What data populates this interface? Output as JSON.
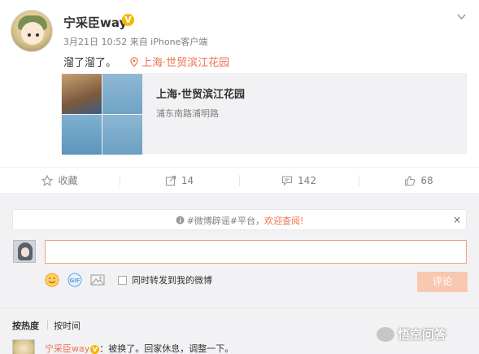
{
  "post": {
    "username": "宁采臣way",
    "verified_badge": "V",
    "meta": "3月21日 10:52 来自 iPhone客户端",
    "text": "溜了溜了。",
    "location_link": "上海·世贸滨江花园",
    "card": {
      "title": "上海·世贸滨江花园",
      "subtitle": "浦东南路浦明路"
    }
  },
  "actions": {
    "favorite": "收藏",
    "repost_count": "14",
    "comment_count": "142",
    "like_count": "68"
  },
  "comments": {
    "notice_prefix": "#微博辟谣#平台，",
    "notice_highlight": "欢迎查阅!",
    "notice_close": "×",
    "forward_label": "同时转发到我的微博",
    "submit_label": "评论",
    "sort_hot": "按热度",
    "sort_time": "按时间",
    "first_comment": {
      "user": "宁采臣way",
      "badge": "V",
      "text": "：被换了。回家休息，调整一下。"
    }
  },
  "watermark": "悟空问答",
  "colors": {
    "accent": "#eb7350",
    "badge": "#f7b500",
    "muted": "#808080"
  }
}
